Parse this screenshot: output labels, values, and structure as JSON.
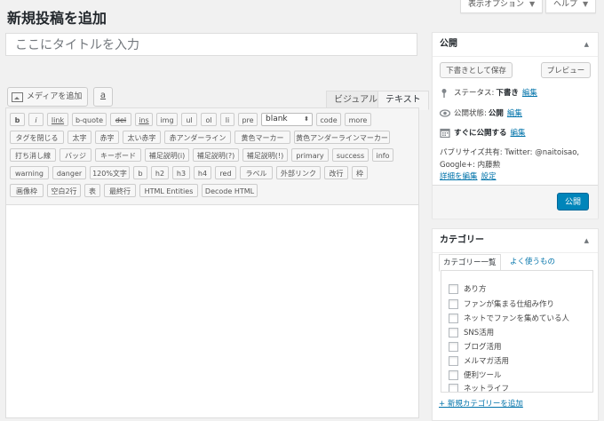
{
  "header": {
    "title": "新規投稿を追加",
    "screen_options": "表示オプション",
    "help": "ヘルプ"
  },
  "post": {
    "title_placeholder": "ここにタイトルを入力"
  },
  "editor": {
    "add_media": "メディアを追加",
    "a_button": "a",
    "tab_visual": "ビジュアル",
    "tab_text": "テキスト",
    "quicktags": {
      "row1": [
        "b",
        "i",
        "link",
        "b-quote",
        "del",
        "ins",
        "img",
        "ul",
        "ol",
        "li",
        "pre"
      ],
      "select_value": "blank",
      "row1_after": [
        "code",
        "more"
      ],
      "row2": [
        "タグを閉じる",
        "太字",
        "赤字",
        "太い赤字",
        "赤アンダーライン",
        "黄色マーカー",
        "黄色アンダーラインマーカー"
      ],
      "row3": [
        "打ち消し線",
        "バッジ",
        "キーボード",
        "補足説明(i)",
        "補足説明(?)",
        "補足説明(!)",
        "primary",
        "success",
        "info"
      ],
      "row4": [
        "warning",
        "danger",
        "120%文字",
        "b",
        "h2",
        "h3",
        "h4",
        "red",
        "ラベル",
        "外部リンク",
        "改行",
        "枠"
      ],
      "row5": [
        "画像枠",
        "空白2行",
        "表",
        "最終行",
        "HTML Entities",
        "Decode HTML"
      ]
    }
  },
  "publish_box": {
    "title": "公開",
    "save_draft": "下書きとして保存",
    "preview": "プレビュー",
    "status_label": "ステータス:",
    "status_value": "下書き",
    "visibility_label": "公開状態:",
    "visibility_value": "公開",
    "schedule_label": "すぐに公開する",
    "edit_link": "編集",
    "publicize_line1": "パブリサイズ共有: Twitter: @naitoisao,",
    "publicize_line2": "Google+: 内藤勲",
    "publicize_edit": "詳細を編集",
    "publicize_settings": "設定",
    "publish_button": "公開"
  },
  "category_box": {
    "title": "カテゴリー",
    "tab_all": "カテゴリー一覧",
    "tab_popular": "よく使うもの",
    "items": [
      "あり方",
      "ファンが集まる仕組み作り",
      "ネットでファンを集めている人",
      "SNS活用",
      "ブログ活用",
      "メルマガ活用",
      "便利ツール",
      "ネットライフ"
    ],
    "add_new": "+ 新規カテゴリーを追加"
  },
  "colors": {
    "accent": "#0073aa",
    "primary_button": "#0085ba",
    "background": "#f1f1f1"
  }
}
